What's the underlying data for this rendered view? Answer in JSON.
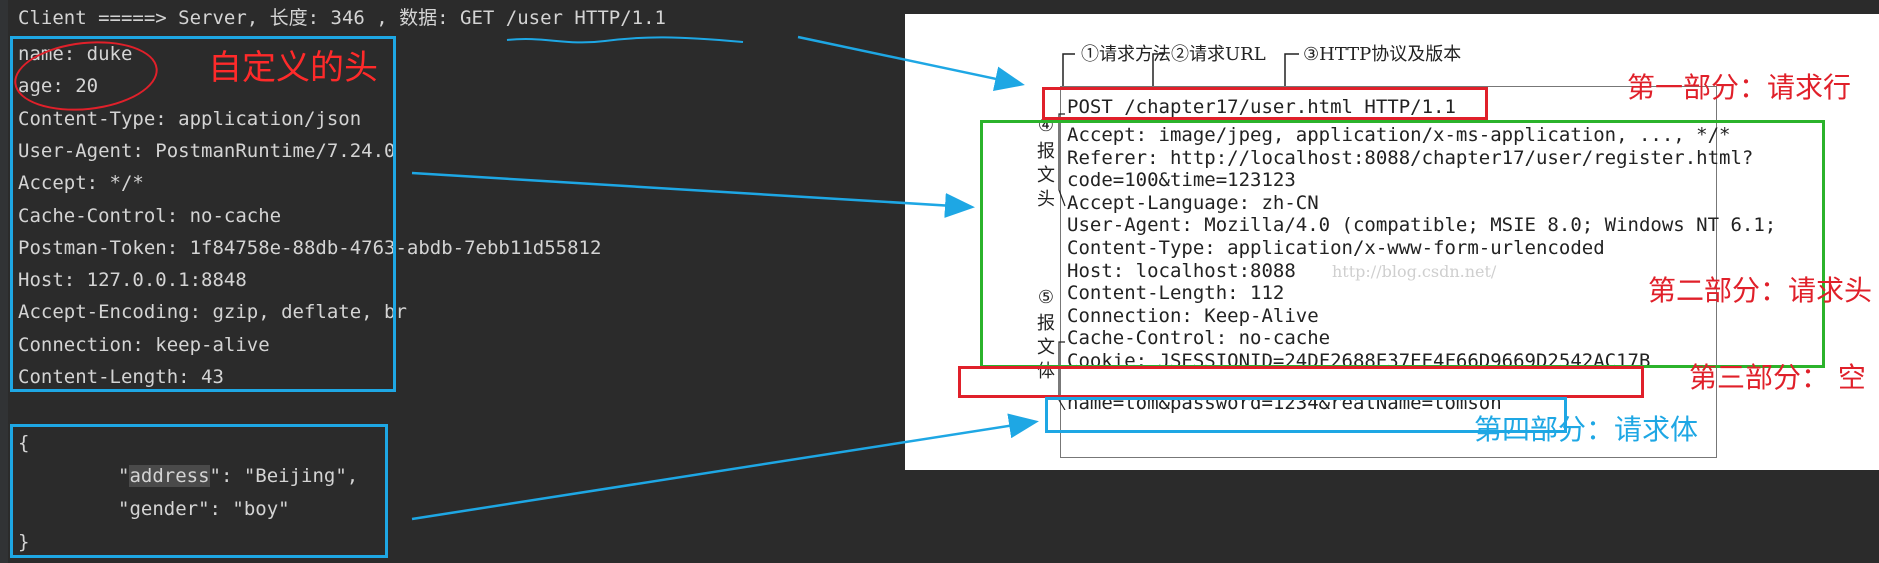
{
  "console": {
    "header_line": "Client =====> Server, 长度: 346 , 数据: GET /user HTTP/1.1",
    "headers": [
      "name: duke",
      "age: 20",
      "Content-Type: application/json",
      "User-Agent: PostmanRuntime/7.24.0",
      "Accept: */*",
      "Cache-Control: no-cache",
      "Postman-Token: 1f84758e-88db-4763-abdb-7ebb11d55812",
      "Host: 127.0.0.1:8848",
      "Accept-Encoding: gzip, deflate, br",
      "Connection: keep-alive",
      "Content-Length: 43"
    ],
    "body_open": "{",
    "body_address_q1": "\"",
    "body_address_key": "address",
    "body_address_rest": "\": \"Beijing\",",
    "body_gender": "\"gender\": \"boy\"",
    "body_close": "}",
    "custom_header_annotation": "自定义的头"
  },
  "figure": {
    "top_labels": {
      "method": "①请求方法",
      "url": "②请求URL",
      "protocol": "③HTTP协议及版本"
    },
    "request_line": "POST /chapter17/user.html HTTP/1.1",
    "header_lines": [
      "Accept: image/jpeg, application/x-ms-application, ..., */*",
      "Referer: http://localhost:8088/chapter17/user/register.html?",
      "code=100&time=123123",
      "Accept-Language: zh-CN",
      "User-Agent: Mozilla/4.0 (compatible; MSIE 8.0; Windows NT 6.1;",
      "Content-Type: application/x-www-form-urlencoded",
      "Host: localhost:8088",
      "Content-Length: 112",
      "Connection: Keep-Alive",
      "Cache-Control: no-cache",
      "Cookie: JSESSIONID=24DF2688E37EE4F66D9669D2542AC17B"
    ],
    "body_line": "name=tom&password=1234&realName=tomson",
    "side_label_headers_num": "④",
    "side_label_headers": "报文头",
    "side_label_body_num": "⑤",
    "side_label_body": "报文体",
    "watermark": "http://blog.csdn.net/",
    "section_request_line": "第一部分：请求行",
    "section_request_headers": "第二部分：请求头",
    "section_blank": "第三部分：  空",
    "section_request_body": "第四部分：请求体"
  },
  "colors": {
    "annotation_blue": "#1ea7e4",
    "annotation_red": "#e0202a",
    "annotation_green": "#2bb32b"
  }
}
